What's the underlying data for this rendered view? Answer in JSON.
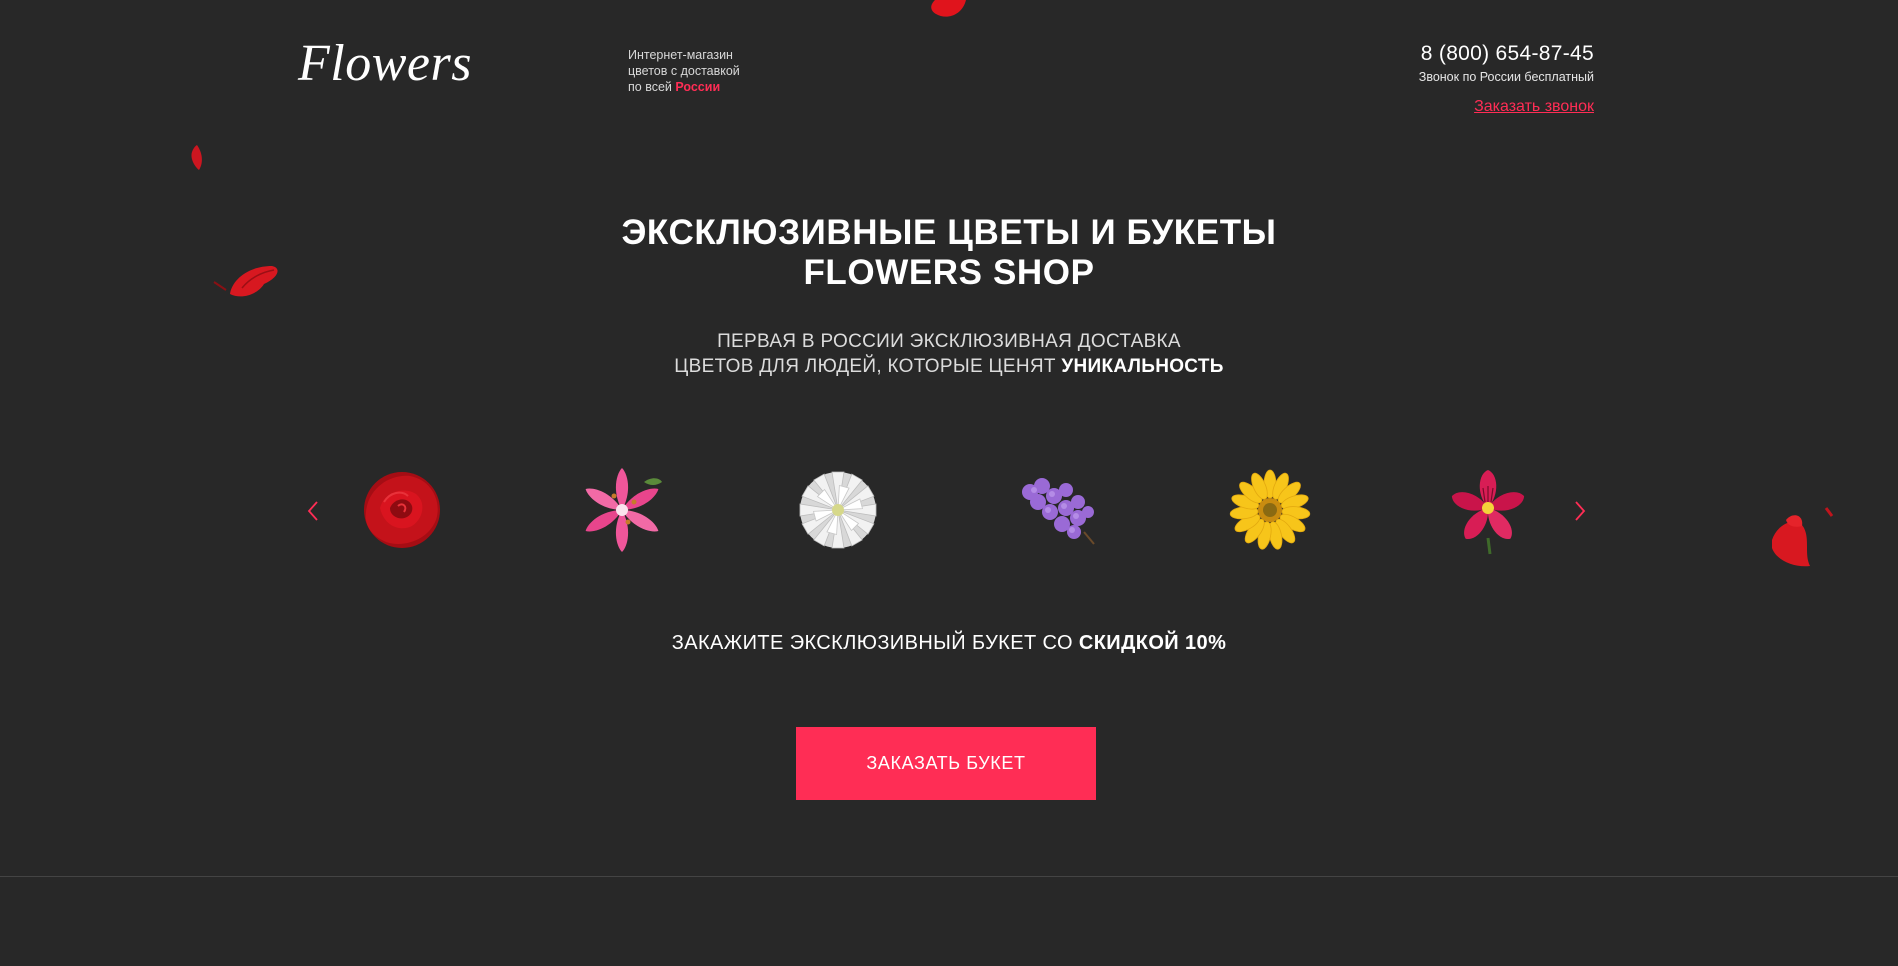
{
  "header": {
    "logo": "Flowers",
    "tagline_line1": "Интернет-магазин",
    "tagline_line2": "цветов с доставкой",
    "tagline_line3_prefix": "по всей ",
    "tagline_line3_highlight": "России",
    "phone": "8 (800) 654-87-45",
    "phone_note": "Звонок по России бесплатный",
    "callback_link": "Заказать звонок"
  },
  "hero": {
    "title_line1": "ЭКСКЛЮЗИВНЫЕ ЦВЕТЫ И БУКЕТЫ",
    "title_line2": "FLOWERS SHOP",
    "subtitle_line1": "ПЕРВАЯ В РОССИИ ЭКСКЛЮЗИВНАЯ ДОСТАВКА",
    "subtitle_line2_prefix": "ЦВЕТОВ ДЛЯ ЛЮДЕЙ, КОТОРЫЕ ЦЕНЯТ ",
    "subtitle_line2_strong": "УНИКАЛЬНОСТЬ"
  },
  "carousel": {
    "prev_icon": "chevron-left-icon",
    "next_icon": "chevron-right-icon",
    "items": [
      {
        "icon": "rose-icon",
        "color": "#c4121a"
      },
      {
        "icon": "lily-icon",
        "color": "#f0569a"
      },
      {
        "icon": "dahlia-icon",
        "color": "#f2f2f2"
      },
      {
        "icon": "lilac-icon",
        "color": "#9a6ad6"
      },
      {
        "icon": "gerbera-icon",
        "color": "#f7c51a"
      },
      {
        "icon": "alstroemeria-icon",
        "color": "#d81d55"
      }
    ]
  },
  "promo": {
    "text_prefix": "ЗАКАЖИТЕ ЭКСКЛЮЗИВНЫЙ БУКЕТ СО ",
    "text_strong": "СКИДКОЙ 10%"
  },
  "cta": {
    "label": "ЗАКАЗАТЬ БУКЕТ"
  },
  "colors": {
    "background": "#282828",
    "accent": "#ff2d55",
    "petal": "#d81820"
  }
}
